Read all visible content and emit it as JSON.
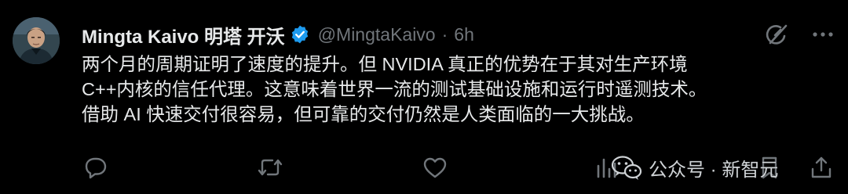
{
  "author": {
    "display_name": "Mingta Kaivo 明塔 开沃",
    "handle": "@MingtaKaivo",
    "separator": "·",
    "time": "6h",
    "verified": true
  },
  "post": {
    "lines": [
      "两个月的周期证明了速度的提升。但 NVIDIA 真正的优势在于其对生产环境",
      "C++内核的信任代理。这意味着世界一流的测试基础设施和运行时遥测技术。",
      "借助 AI 快速交付很容易，但可靠的交付仍然是人类面临的一大挑战。"
    ]
  },
  "watermark": {
    "text": "公众号 · 新智元"
  },
  "icons": {
    "verified": "verified-badge-icon",
    "grok": "grok-icon",
    "more": "more-icon",
    "reply": "reply-icon",
    "retweet": "retweet-icon",
    "like": "like-icon",
    "views": "views-icon",
    "bookmark": "bookmark-icon",
    "share": "share-icon",
    "watermark_logo": "wechat-logo-icon"
  },
  "colors": {
    "background": "#000000",
    "text": "#e7e9ea",
    "muted": "#71767b",
    "verified_blue": "#1d9bf0"
  }
}
